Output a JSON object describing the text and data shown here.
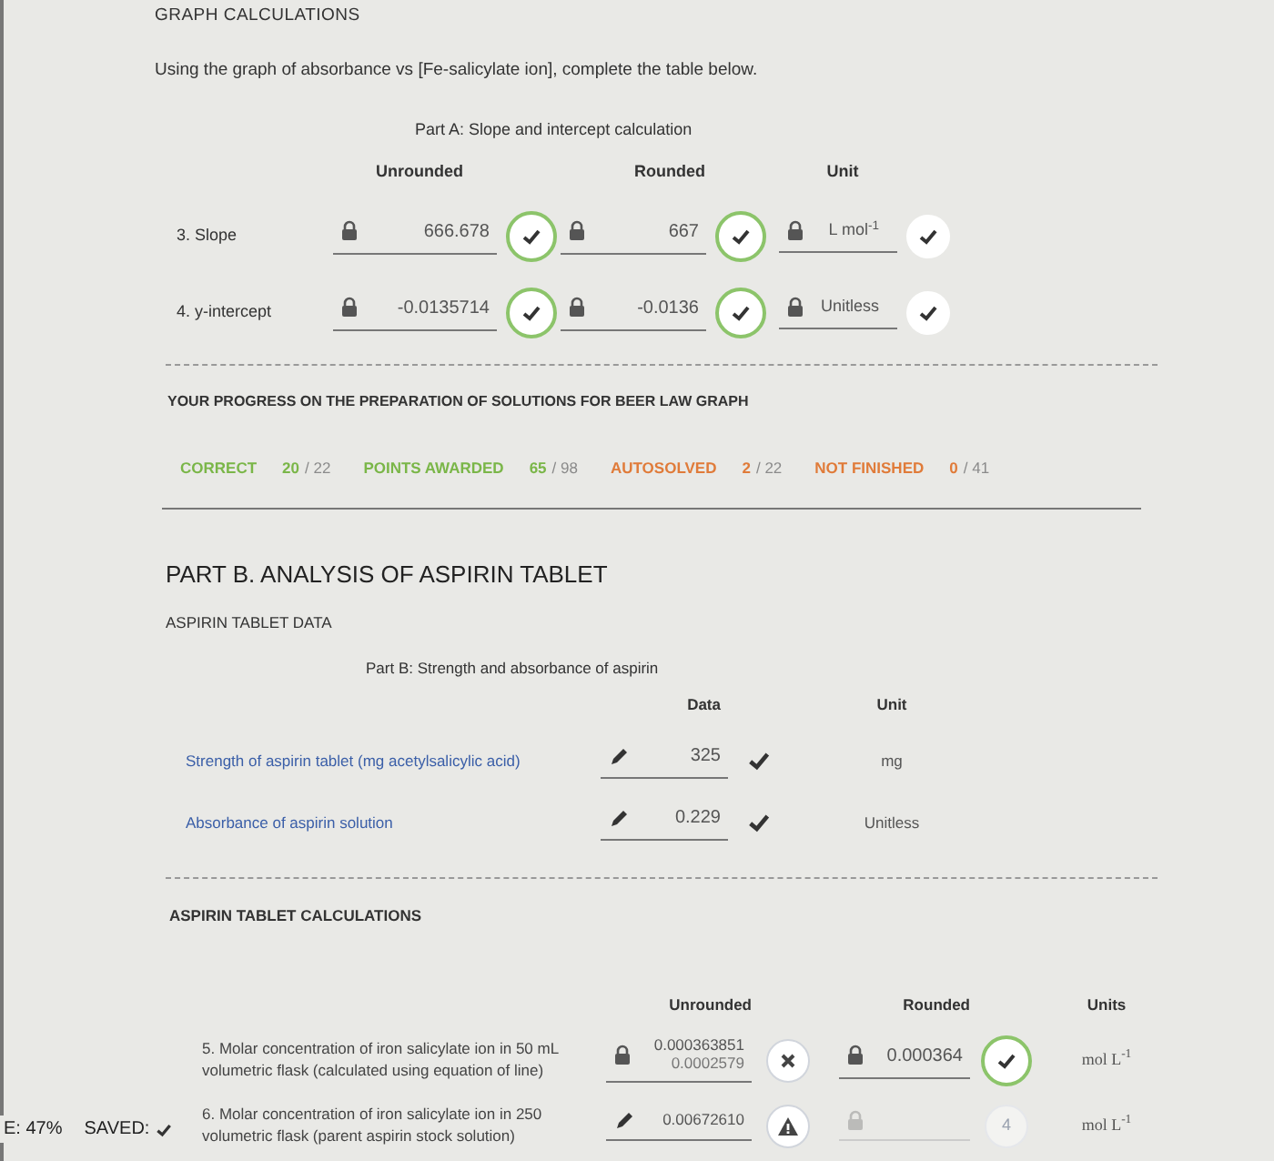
{
  "section_title": "GRAPH CALCULATIONS",
  "instruction": "Using the graph of absorbance vs [Fe-salicylate ion], complete the table below.",
  "part_a": {
    "caption": "Part A: Slope and intercept calculation",
    "headers": [
      "Unrounded",
      "Rounded",
      "Unit"
    ],
    "rows": [
      {
        "label": "3. Slope",
        "unrounded": {
          "value": "666.678",
          "status": {
            "kind": "ring"
          }
        },
        "rounded": {
          "value": "667",
          "status": {
            "kind": "ring"
          }
        },
        "unit": {
          "value": "L mol$^{-1}$",
          "status": {
            "kind": "circle"
          }
        }
      },
      {
        "label": "4. y-intercept",
        "unrounded": {
          "value": "-0.0135714",
          "status": {
            "kind": "ring"
          }
        },
        "rounded": {
          "value": "-0.0136",
          "status": {
            "kind": "ring"
          }
        },
        "unit": {
          "value": "Unitless",
          "status": {
            "kind": "circle"
          }
        }
      }
    ]
  },
  "progress": {
    "title": "YOUR PROGRESS ON THE PREPARATION OF SOLUTIONS FOR BEER LAW GRAPH",
    "items": [
      {
        "label": "CORRECT",
        "value": "20",
        "total": "/ 22",
        "color": "#7ab648"
      },
      {
        "label": "POINTS AWARDED",
        "value": "65",
        "total": "/ 98",
        "color": "#7ab648"
      },
      {
        "label": "AUTOSOLVED",
        "value": "2",
        "total": "/ 22",
        "color": "#e07b39"
      },
      {
        "label": "NOT FINISHED",
        "value": "0",
        "total": "/ 41",
        "color": "#e07b39"
      }
    ]
  },
  "part_b": {
    "title": "PART B. ANALYSIS OF ASPIRIN TABLET",
    "data_title": "ASPIRIN TABLET DATA",
    "caption": "Part B: Strength and absorbance of aspirin",
    "headers": [
      "Data",
      "Unit"
    ],
    "rows": [
      {
        "label": "Strength of aspirin tablet (mg acetylsalicylic acid)",
        "value": "325",
        "status": {
          "kind": "tick"
        },
        "unit": "mg"
      },
      {
        "label": "Absorbance of aspirin solution",
        "value": "0.229",
        "status": {
          "kind": "tick"
        },
        "unit": "Unitless"
      }
    ]
  },
  "calculations": {
    "title": "ASPIRIN TABLET CALCULATIONS",
    "headers": [
      "Unrounded",
      "Rounded",
      "Units"
    ],
    "rows": [
      {
        "label": "5. Molar concentration of iron salicylate ion in 50 mL volumetric flask (calculated using equation of line)",
        "unrounded": {
          "kind": "lock",
          "value": "0.000363851",
          "previous_value": "0.0002579",
          "status": {
            "kind": "wrong"
          }
        },
        "rounded": {
          "kind": "lock",
          "disabled": false,
          "value": "0.000364",
          "status": {
            "kind": "ring"
          }
        },
        "unit": "mol L$^{-1}$"
      },
      {
        "label": "6. Molar concentration of iron salicylate ion in 250 volumetric flask (parent aspirin stock solution)",
        "unrounded": {
          "kind": "pencil",
          "value": "0.00672610",
          "status": {
            "kind": "warning"
          }
        },
        "rounded": {
          "kind": "lock",
          "disabled": true,
          "status": {
            "kind": "count",
            "text": "4"
          }
        },
        "unit": "mol L$^{-1}$"
      }
    ]
  },
  "status_bar": {
    "score": "E: 47%",
    "saved": "SAVED:"
  }
}
